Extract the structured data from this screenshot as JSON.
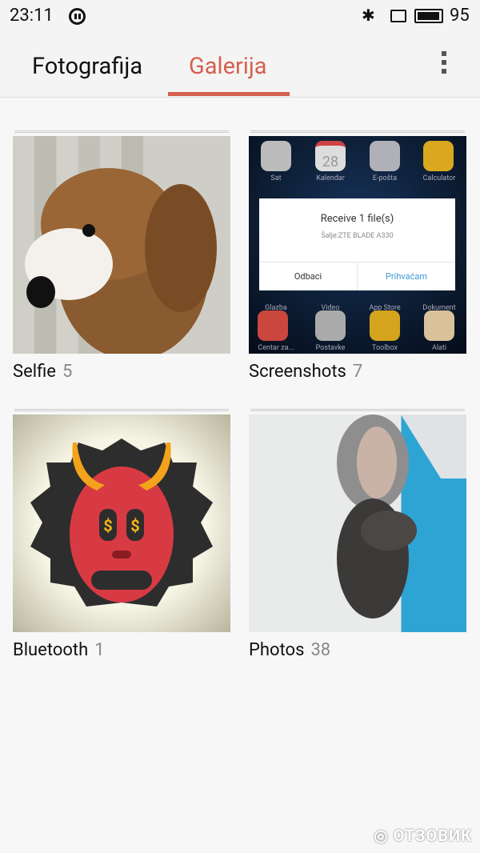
{
  "status": {
    "time": "23:11",
    "battery": "95",
    "battery_level": 95,
    "icons": [
      "pause-icon",
      "bluetooth-icon",
      "sim-icon",
      "battery-icon"
    ]
  },
  "tabs": [
    {
      "label": "Fotografija",
      "active": false
    },
    {
      "label": "Galerija",
      "active": true
    }
  ],
  "accent": "#d5604f",
  "albums": [
    {
      "name": "Selfie",
      "count": "5"
    },
    {
      "name": "Screenshots",
      "count": "7"
    },
    {
      "name": "Bluetooth",
      "count": "1"
    },
    {
      "name": "Photos",
      "count": "38"
    }
  ],
  "screenshot_thumb": {
    "apps": [
      "Sat",
      "Kalendar",
      "E-pošta",
      "Calculator",
      "Glazba",
      "Video",
      "App Store",
      "Dokument",
      "Centar za...",
      "Postavke",
      "Toolbox",
      "Alati"
    ],
    "calendar_day": "28",
    "dialog": {
      "title": "Receive 1 file(s)",
      "subtitle": "Šalje:ZTE BLADE A330",
      "cancel": "Odbaci",
      "accept": "Prihvaćam"
    }
  },
  "watermark": "ОТЗОВИК"
}
